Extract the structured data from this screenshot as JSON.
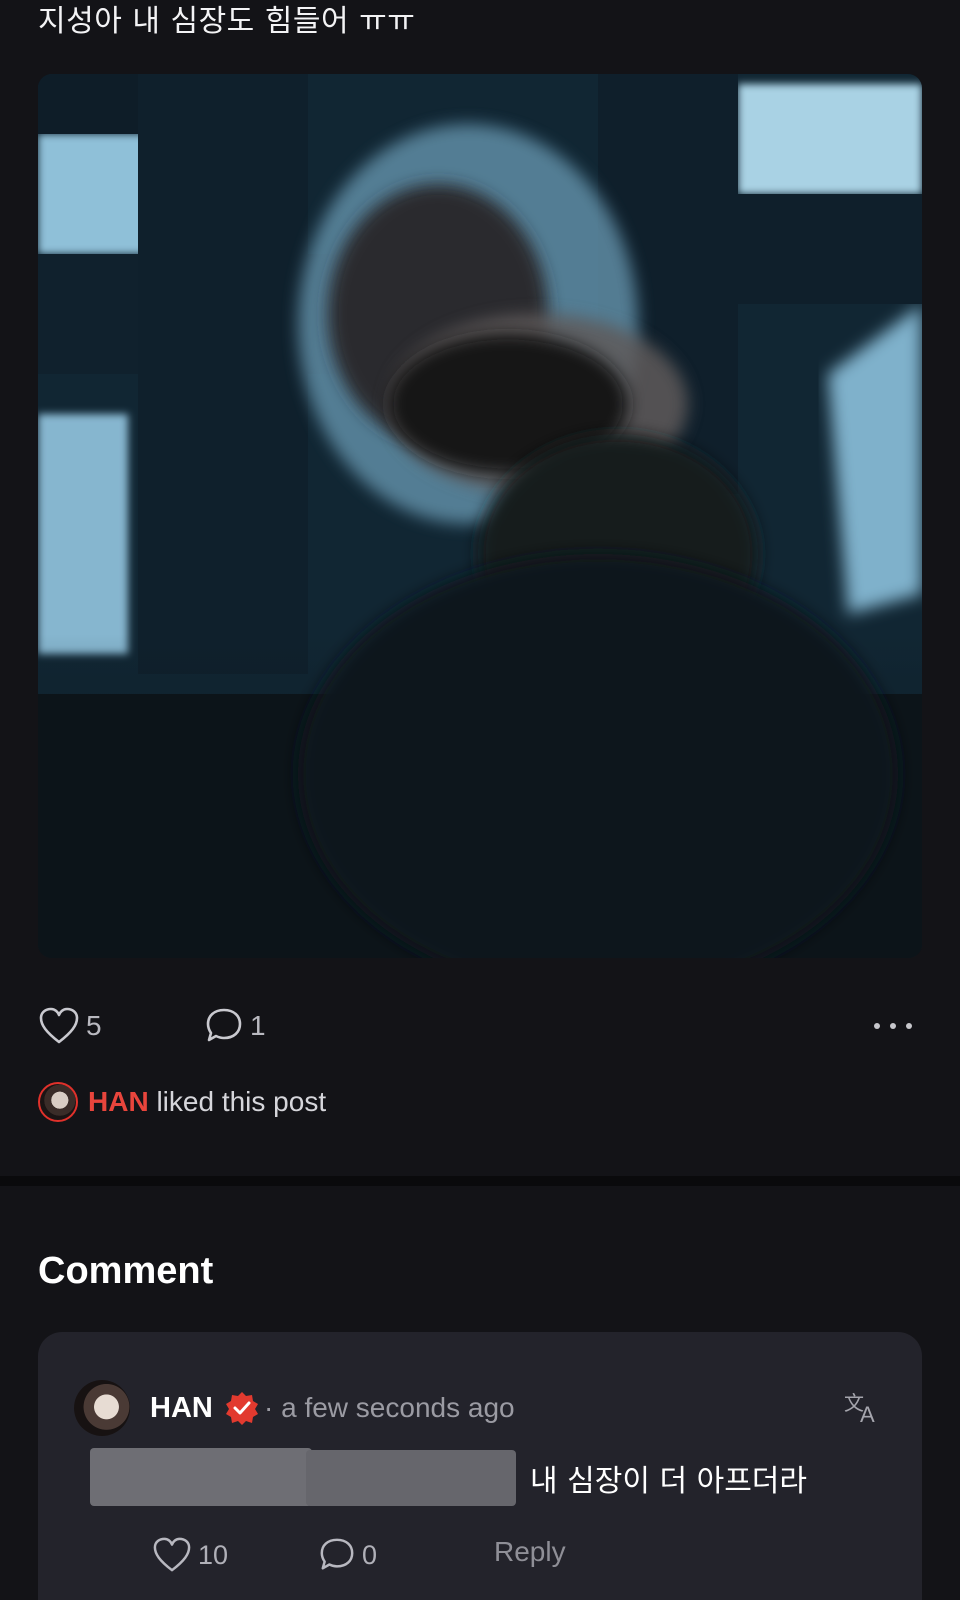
{
  "post": {
    "title": "지성아 내 심장도 힘들어 ㅠㅠ",
    "likes": "5",
    "comments": "1",
    "liked_by": {
      "name": "HAN",
      "suffix": "liked this post"
    }
  },
  "comments_section": {
    "heading": "Comment",
    "items": [
      {
        "author": "HAN",
        "time": "· a few seconds ago",
        "text": "내 심장이 더 아프더라",
        "likes": "10",
        "replies": "0",
        "reply_label": "Reply"
      }
    ]
  },
  "colors": {
    "background": "#131317",
    "card": "#23232b",
    "accent_red": "#e8453c"
  },
  "icons": [
    "heart-icon",
    "comment-bubble-icon",
    "more-icon",
    "verified-badge-icon",
    "translate-icon"
  ]
}
